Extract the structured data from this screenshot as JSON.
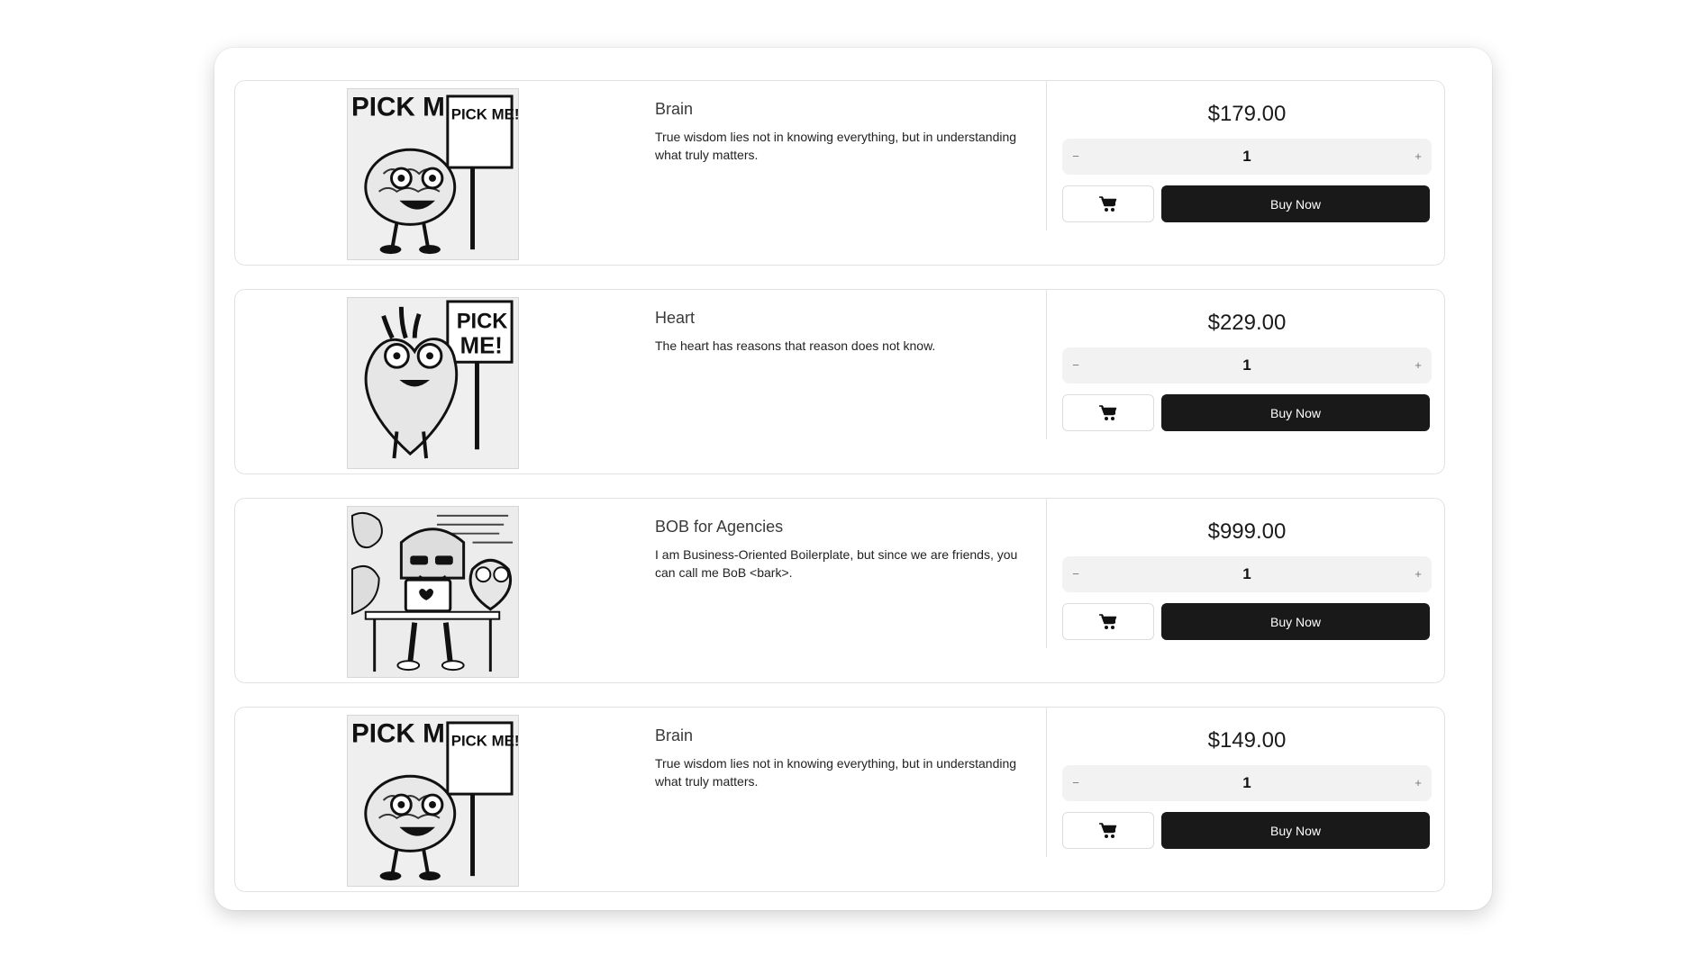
{
  "products": [
    {
      "title": "Brain",
      "description": "True wisdom lies not in knowing everything, but in understanding what truly matters.",
      "price": "$179.00",
      "quantity": "1",
      "minus": "−",
      "plus": "+",
      "buy_label": "Buy Now",
      "image_icon": "brain-pick-me-illustration"
    },
    {
      "title": "Heart",
      "description": "The heart has reasons that reason does not know.",
      "price": "$229.00",
      "quantity": "1",
      "minus": "−",
      "plus": "+",
      "buy_label": "Buy Now",
      "image_icon": "heart-pick-me-illustration"
    },
    {
      "title": "BOB for Agencies",
      "description": "I am Business-Oriented Boilerplate, but since we are friends, you can call me BoB <bark>.",
      "price": "$999.00",
      "quantity": "1",
      "minus": "−",
      "plus": "+",
      "buy_label": "Buy Now",
      "image_icon": "dog-at-desk-illustration"
    },
    {
      "title": "Brain",
      "description": "True wisdom lies not in knowing everything, but in understanding what truly matters.",
      "price": "$149.00",
      "quantity": "1",
      "minus": "−",
      "plus": "+",
      "buy_label": "Buy Now",
      "image_icon": "brain-pick-me-illustration"
    }
  ],
  "illustration_text": "PICK ME!",
  "cart_icon": "cart-icon",
  "colors": {
    "buy_button_bg": "#191919",
    "stepper_bg": "#f2f2f2",
    "border": "#e2e2e2"
  }
}
